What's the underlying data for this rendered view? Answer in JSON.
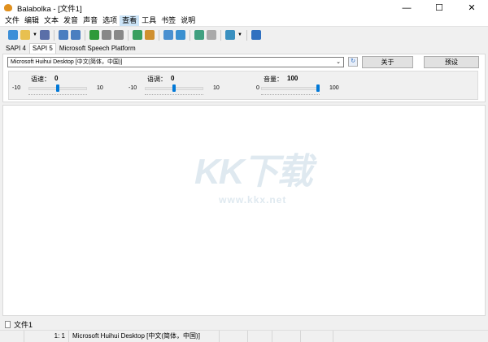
{
  "window": {
    "title": "Balabolka - [文件1]",
    "minimize": "—",
    "maximize": "☐",
    "close": "✕"
  },
  "menu": [
    "文件",
    "编辑",
    "文本",
    "发音",
    "声音",
    "选项",
    "查看",
    "工具",
    "书签",
    "说明"
  ],
  "menu_active": "查看",
  "toolbar": {
    "icons": [
      "new-file-icon",
      "open-folder-icon",
      "save-icon",
      "read-clipboard-icon",
      "read-file-icon",
      "play-icon",
      "pause-icon",
      "stop-icon",
      "convert-icon",
      "batch-icon",
      "view-icon",
      "dictionary-icon",
      "split-icon",
      "join-icon",
      "voice-icon",
      "help-icon"
    ]
  },
  "engine_tabs": [
    "SAPI 4",
    "SAPI 5",
    "Microsoft Speech Platform"
  ],
  "voice": {
    "selected": "Microsoft Huihui Desktop [中文(简体，中国)]",
    "about_label": "关于",
    "preset_label": "预设"
  },
  "sliders": [
    {
      "label": "语速：",
      "value": "0",
      "min": "-10",
      "max": "10",
      "fraction": 0.5
    },
    {
      "label": "语调：",
      "value": "0",
      "min": "-10",
      "max": "10",
      "fraction": 0.5
    },
    {
      "label": "音量：",
      "value": "100",
      "min": "0",
      "max": "100",
      "fraction": 1.0
    }
  ],
  "watermark": {
    "logo": "KK下载",
    "url": "www.kkx.net"
  },
  "doc_tabs": [
    "文件1"
  ],
  "status": {
    "position": "1:   1",
    "voice": "Microsoft Huihui Desktop [中文(简体，中国)]"
  },
  "colors": {
    "accent": "#0078d7",
    "menu_highlight": "#cce4f7"
  }
}
